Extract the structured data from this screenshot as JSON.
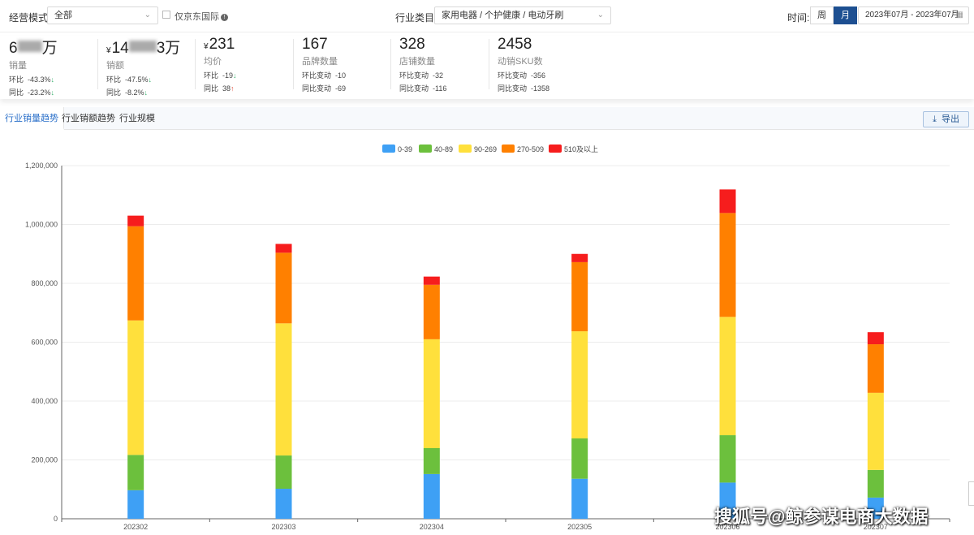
{
  "filters": {
    "mode_label": "经营模式:",
    "mode_value": "全部",
    "jd_intl_label": "仅京东国际",
    "category_label": "行业类目:",
    "category_value": "家用电器 / 个护健康 / 电动牙刷",
    "time_label": "时间:",
    "period_week": "周",
    "period_month": "月",
    "date_range": "2023年07月 - 2023年07月"
  },
  "stats": [
    {
      "value_a": "6",
      "value_b": "万",
      "currency": "",
      "label": "销量",
      "row1_key": "环比",
      "row1_val": "-43.3%",
      "row1_arrow": "↓",
      "row2_key": "同比",
      "row2_val": "-23.2%",
      "row2_arrow": "↓"
    },
    {
      "value_a": "14",
      "value_b": "3万",
      "currency": "¥",
      "label": "销额",
      "row1_key": "环比",
      "row1_val": "-47.5%",
      "row1_arrow": "↓",
      "row2_key": "同比",
      "row2_val": "-8.2%",
      "row2_arrow": "↓"
    },
    {
      "value_a": "231",
      "value_b": "",
      "currency": "¥",
      "label": "均价",
      "row1_key": "环比",
      "row1_val": "-19",
      "row1_arrow": "↓",
      "row2_key": "同比",
      "row2_val": "38",
      "row2_arrow": "↑"
    },
    {
      "value_a": "167",
      "label": "品牌数量",
      "row1_key": "环比变动",
      "row1_val": "-10",
      "row2_key": "同比变动",
      "row2_val": "-69"
    },
    {
      "value_a": "328",
      "label": "店铺数量",
      "row1_key": "环比变动",
      "row1_val": "-32",
      "row2_key": "同比变动",
      "row2_val": "-116"
    },
    {
      "value_a": "2458",
      "label": "动销SKU数",
      "row1_key": "环比变动",
      "row1_val": "-356",
      "row2_key": "同比变动",
      "row2_val": "-1358"
    }
  ],
  "tabs": [
    "行业销量趋势",
    "行业销额趋势",
    "行业规模"
  ],
  "export_label": "导出",
  "watermark": "搜狐号@鲸参谋电商大数据",
  "colors": {
    "accent": "#1d4f91",
    "link": "#2a6fc9"
  },
  "chart_data": {
    "type": "bar",
    "stacked": true,
    "categories": [
      "202302",
      "202303",
      "202304",
      "202305",
      "202306",
      "202307"
    ],
    "series": [
      {
        "name": "0-39",
        "color": "#3ea0f5",
        "values": [
          97000,
          102000,
          152000,
          136000,
          123000,
          72000
        ]
      },
      {
        "name": "40-89",
        "color": "#6cc03d",
        "values": [
          120000,
          113000,
          88000,
          137000,
          161000,
          94000
        ]
      },
      {
        "name": "90-269",
        "color": "#ffe03c",
        "values": [
          457000,
          449000,
          370000,
          364000,
          402000,
          262000
        ]
      },
      {
        "name": "270-509",
        "color": "#ff8000",
        "values": [
          320000,
          240000,
          185000,
          235000,
          353000,
          165000
        ]
      },
      {
        "name": "510及以上",
        "color": "#f61d1d",
        "values": [
          36000,
          30000,
          28000,
          28000,
          80000,
          41000
        ]
      }
    ],
    "yticks": [
      "0",
      "200,000",
      "400,000",
      "600,000",
      "800,000",
      "1,000,000",
      "1,200,000"
    ],
    "ylim": [
      0,
      1200000
    ],
    "grid": true,
    "legend_position": "top-center"
  }
}
